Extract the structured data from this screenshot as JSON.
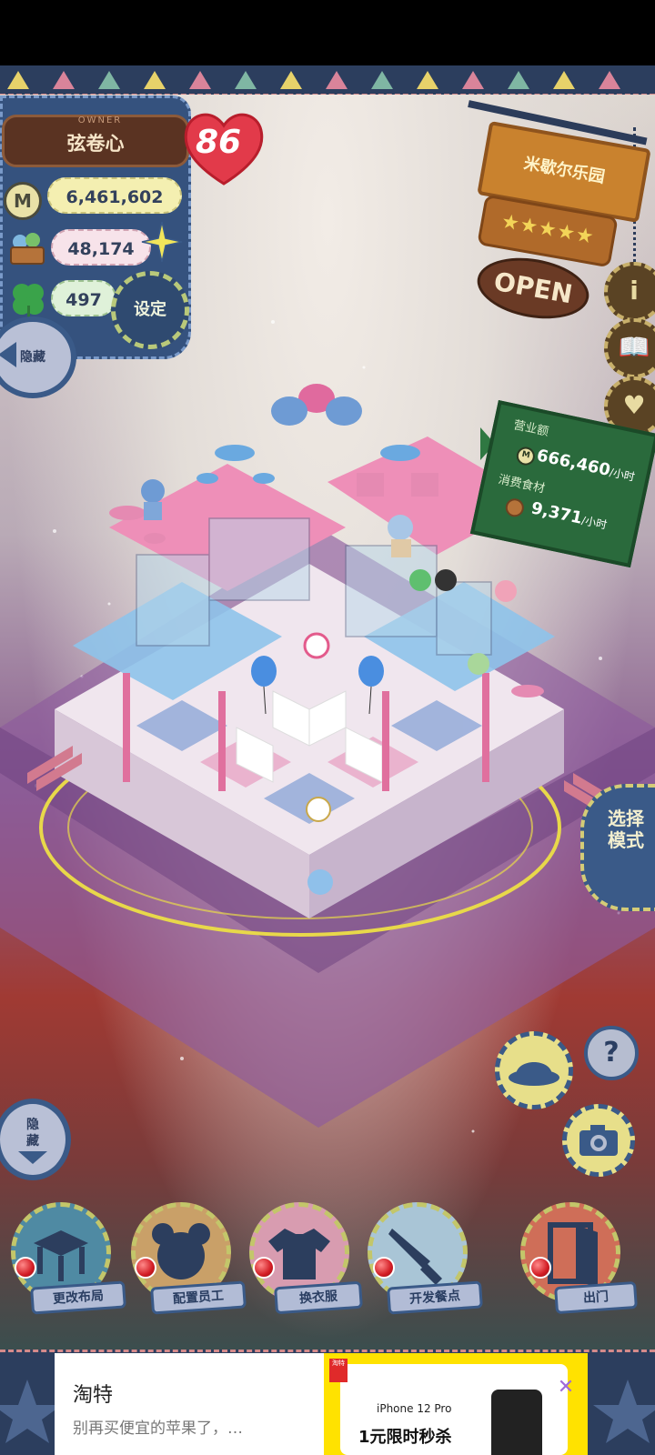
{
  "player": {
    "owner_label": "OWNER",
    "name": "弦卷心",
    "level": "86",
    "money": "6,461,602",
    "food": "48,174",
    "clover": "497",
    "money_icon_letter": "M"
  },
  "buttons": {
    "settings": "设定",
    "hide_top": "隐藏",
    "hide_bottom": "隐\n藏",
    "mode": "选择\n模式",
    "help": "?"
  },
  "shop": {
    "name": "米歇尔乐园",
    "stars": "★★★★★",
    "status": "OPEN"
  },
  "revenue": {
    "revenue_label": "营业额",
    "revenue_value": "666,460",
    "revenue_unit": "/小时",
    "food_label": "消费食材",
    "food_value": "9,371",
    "food_unit": "/小时"
  },
  "menu": [
    {
      "label": "更改布局",
      "icon": "table-icon"
    },
    {
      "label": "配置员工",
      "icon": "bear-icon"
    },
    {
      "label": "换衣服",
      "icon": "shirt-icon"
    },
    {
      "label": "开发餐点",
      "icon": "knife-icon"
    },
    {
      "label": "出门",
      "icon": "door-icon"
    }
  ],
  "ad": {
    "brand": "淘特",
    "text": "别再买便宜的苹果了，…",
    "tag": "淘特",
    "product": "iPhone 12 Pro",
    "deal": "1元限时秒杀"
  },
  "colors": {
    "panel_blue": "#35527e",
    "accent_yellow": "#d4cc77",
    "heart_red": "#e23a4a",
    "board_green": "#2a6a3c"
  }
}
